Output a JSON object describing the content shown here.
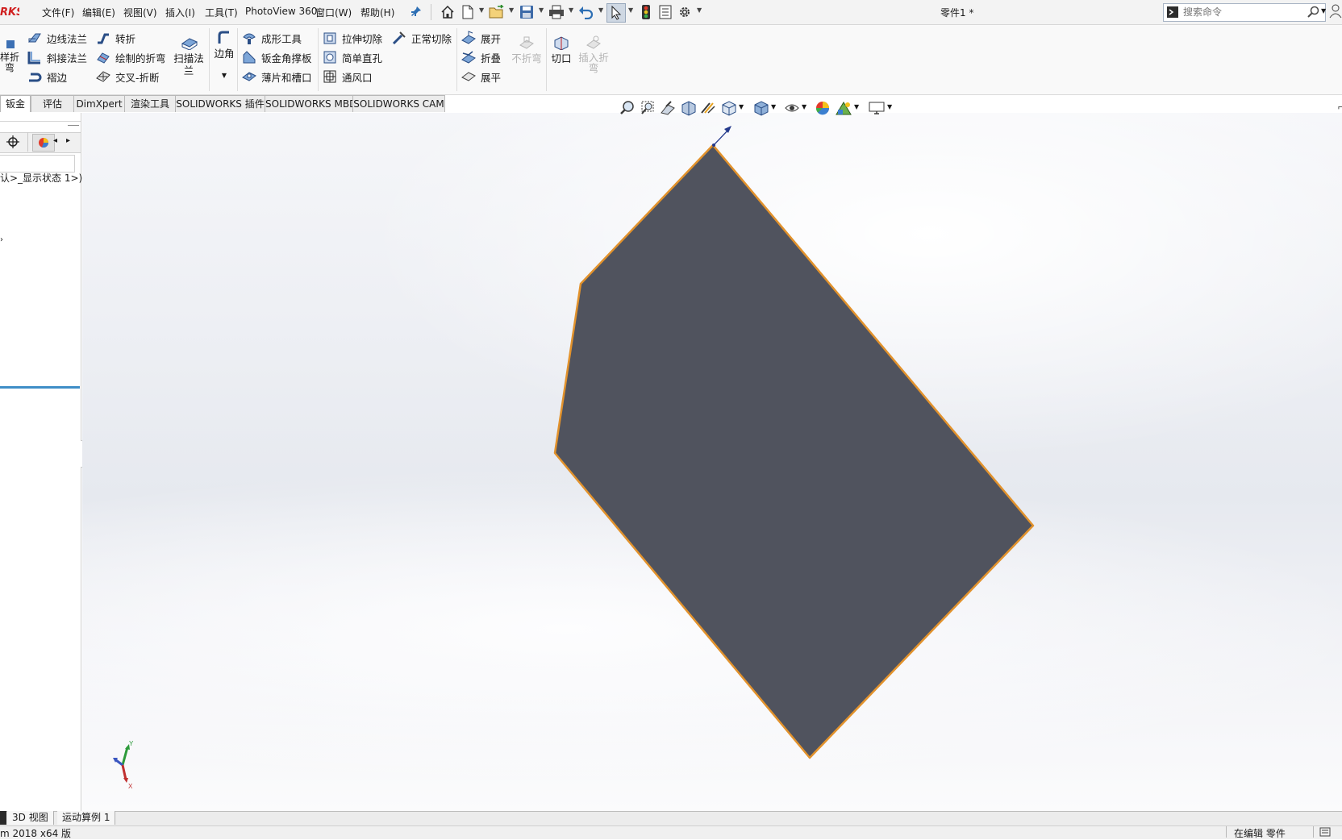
{
  "app": {
    "logo_text": "RKS",
    "document_title": "零件1 *"
  },
  "menu": [
    "文件(F)",
    "编辑(E)",
    "视图(V)",
    "插入(I)",
    "工具(T)",
    "PhotoView 360",
    "窗口(W)",
    "帮助(H)"
  ],
  "search": {
    "placeholder": "搜索命令"
  },
  "ribbon": {
    "left_cut_label": "样折弯",
    "col1": [
      "边线法兰",
      "斜接法兰",
      "褶边"
    ],
    "col2": [
      "转折",
      "绘制的折弯",
      "交叉-折断"
    ],
    "sweep_flange": "扫描法兰",
    "corner": "边角",
    "col3": [
      "成形工具",
      "钣金角撑板",
      "薄片和槽口"
    ],
    "col4": [
      "拉伸切除",
      "简单直孔",
      "通风口"
    ],
    "normal_cut": "正常切除",
    "col5": [
      "展开",
      "折叠",
      "展平"
    ],
    "no_bends": "不折弯",
    "rip": "切口",
    "insert_bends": "插入折弯"
  },
  "tabs": [
    "钣金",
    "评估",
    "DimXpert",
    "渲染工具",
    "SOLIDWORKS 插件",
    "SOLIDWORKS MBD",
    "SOLIDWORKS CAM"
  ],
  "active_tab": "钣金",
  "feature_tree": {
    "config_text": "认>_显示状态 1>)"
  },
  "bottom_tabs": [
    "3D 视图",
    "运动算例 1"
  ],
  "status": {
    "left": "m 2018 x64 版",
    "right": "在编辑 零件"
  },
  "colors": {
    "part_face": "#50535e",
    "part_edge": "#e2922c",
    "accent_tab_line": "#3f8ec7"
  },
  "triad_labels": [
    "Y",
    "X"
  ]
}
